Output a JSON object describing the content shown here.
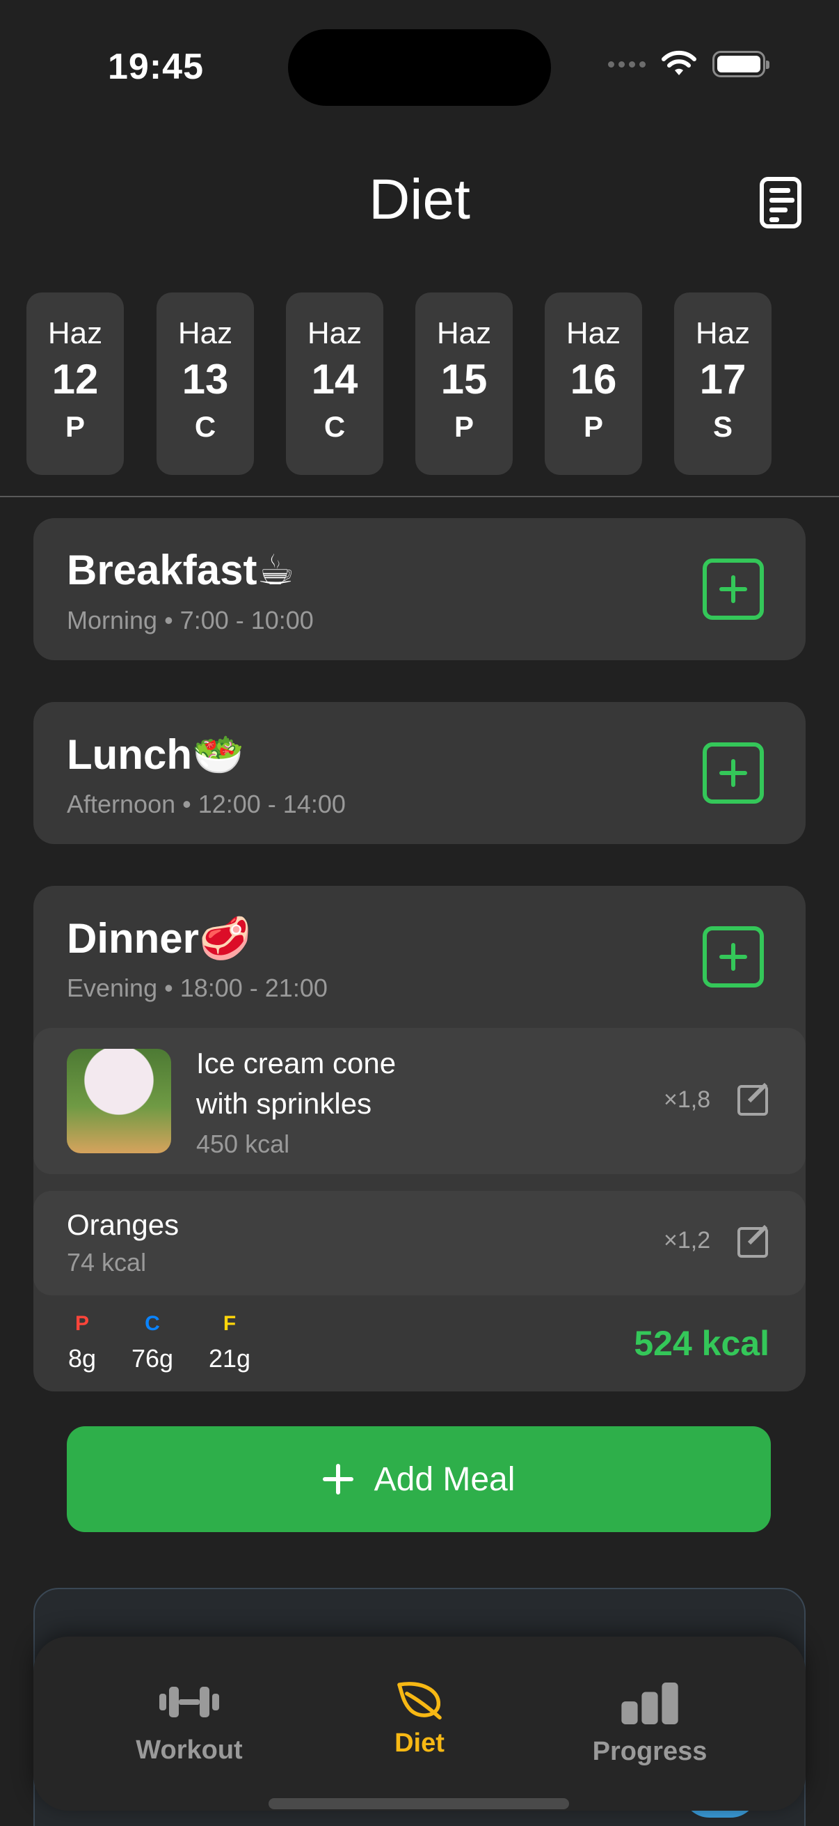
{
  "status_bar": {
    "time": "19:45"
  },
  "header": {
    "title": "Diet"
  },
  "days": [
    {
      "month": "Haz",
      "day": "12",
      "weekday": "P"
    },
    {
      "month": "Haz",
      "day": "13",
      "weekday": "C"
    },
    {
      "month": "Haz",
      "day": "14",
      "weekday": "C"
    },
    {
      "month": "Haz",
      "day": "15",
      "weekday": "P"
    },
    {
      "month": "Haz",
      "day": "16",
      "weekday": "P"
    },
    {
      "month": "Haz",
      "day": "17",
      "weekday": "S"
    }
  ],
  "meals": {
    "breakfast": {
      "title": "Breakfast☕",
      "subtitle": "Morning • 7:00 - 10:00"
    },
    "lunch": {
      "title": "Lunch🥗",
      "subtitle": "Afternoon • 12:00 - 14:00"
    },
    "dinner": {
      "title": "Dinner🥩",
      "subtitle": "Evening • 18:00 - 21:00",
      "items": [
        {
          "name_line1": "Ice cream cone",
          "name_line2": "with sprinkles",
          "kcal": "450 kcal",
          "multiplier": "×1,8"
        },
        {
          "name": "Oranges",
          "kcal": "74 kcal",
          "multiplier": "×1,2"
        }
      ],
      "macros": {
        "protein": {
          "label": "P",
          "value": "8g",
          "color": "#ff453a"
        },
        "carbs": {
          "label": "C",
          "value": "76g",
          "color": "#0a84ff"
        },
        "fat": {
          "label": "F",
          "value": "21g",
          "color": "#ffd60a"
        }
      },
      "total": "524 kcal"
    }
  },
  "add_meal": {
    "label": "Add Meal"
  },
  "tabs": [
    {
      "label": "Workout",
      "icon": "dumbbell-icon",
      "active": false
    },
    {
      "label": "Diet",
      "icon": "leaf-icon",
      "active": true
    },
    {
      "label": "Progress",
      "icon": "bar-chart-icon",
      "active": false
    }
  ],
  "colors": {
    "accent_green": "#34c759",
    "active_tab": "#f7b814",
    "inactive_tab": "#9a9a9a"
  }
}
